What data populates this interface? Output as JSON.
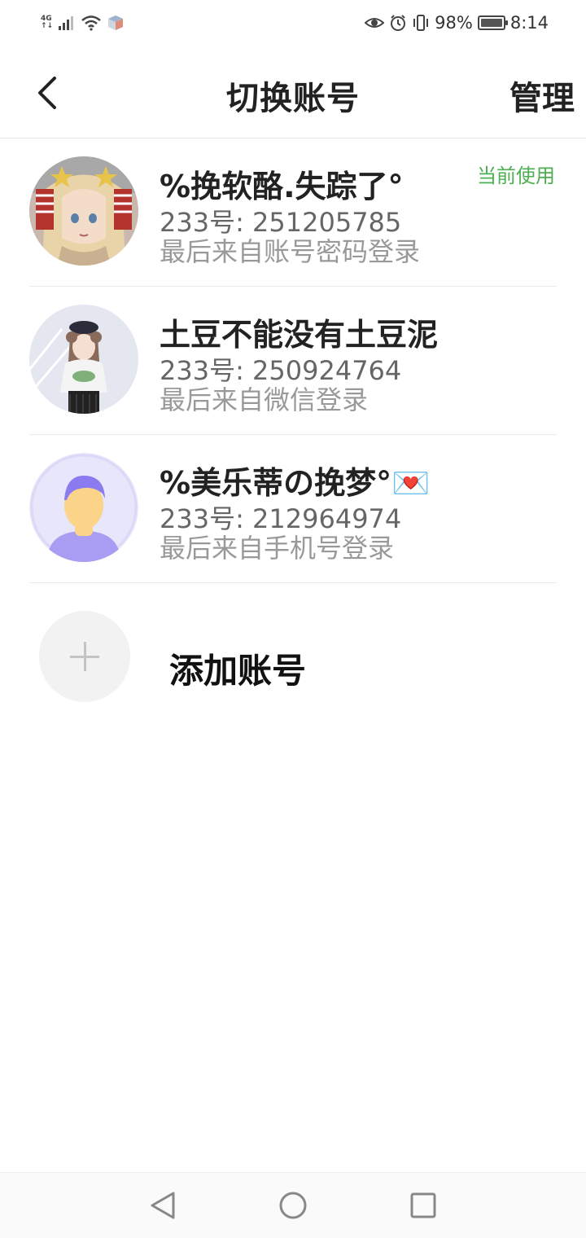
{
  "status_bar": {
    "network": "4G",
    "battery": "98%",
    "time": "8:14"
  },
  "header": {
    "title": "切换账号",
    "manage_label": "管理"
  },
  "accounts": [
    {
      "name": "%挽软酪.失踪了°",
      "id_text": "233号: 251205785",
      "login_text": "最后来自账号密码登录",
      "current_label": "当前使用"
    },
    {
      "name": "土豆不能没有土豆泥",
      "id_text": "233号: 250924764",
      "login_text": "最后来自微信登录"
    },
    {
      "name": "%美乐蒂の挽梦°💌",
      "id_text": "233号: 212964974",
      "login_text": "最后来自手机号登录"
    }
  ],
  "add_account": {
    "label": "添加账号"
  },
  "colors": {
    "current_badge": "#4caf50",
    "default_avatar_bg": "#e8e6fb",
    "default_avatar_accent": "#8a7cf0"
  }
}
